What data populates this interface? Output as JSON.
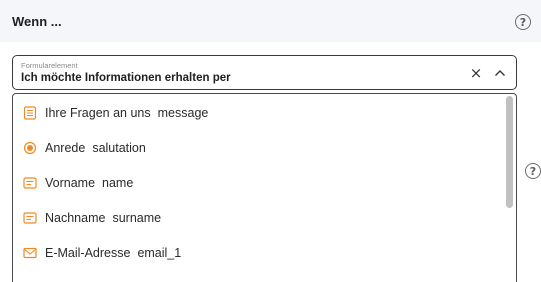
{
  "header": {
    "title": "Wenn ..."
  },
  "field": {
    "label": "Formularelement",
    "value": "Ich möchte Informationen erhalten per",
    "clear_glyph": "×"
  },
  "help": {
    "glyph": "?"
  },
  "options": [
    {
      "label": "Ihre Fragen an uns",
      "key": "message",
      "icon": "textarea-icon"
    },
    {
      "label": "Anrede",
      "key": "salutation",
      "icon": "radio-icon"
    },
    {
      "label": "Vorname",
      "key": "name",
      "icon": "text-field-icon"
    },
    {
      "label": "Nachname",
      "key": "surname",
      "icon": "text-field-icon"
    },
    {
      "label": "E-Mail-Adresse",
      "key": "email_1",
      "icon": "email-icon"
    }
  ],
  "colors": {
    "accent": "#f08a24",
    "header_bg": "#f5f6f9",
    "border": "#3a3a3a"
  }
}
